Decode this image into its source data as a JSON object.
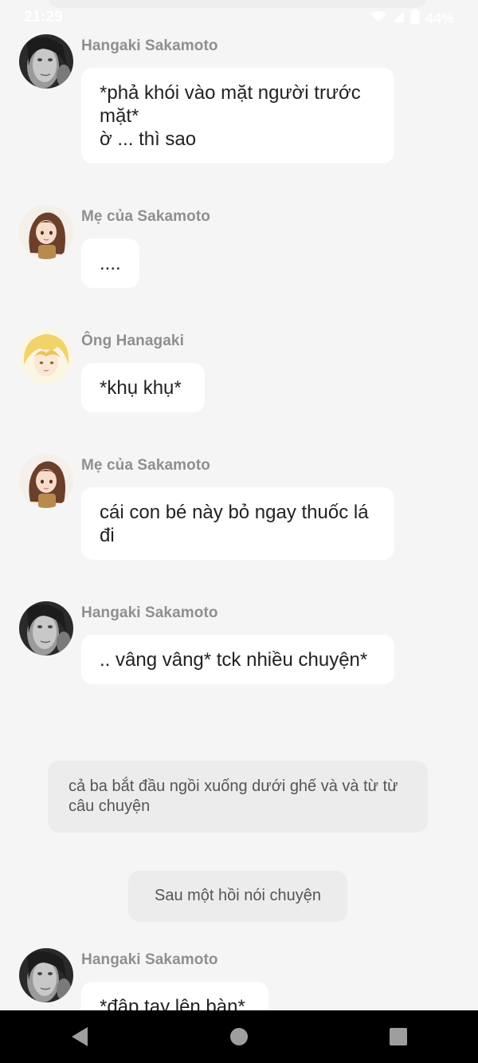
{
  "status_bar": {
    "time": "21:29",
    "battery": "44%"
  },
  "messages": [
    {
      "sender": "Hangaki Sakamoto",
      "avatar": "woman-bw-avatar",
      "text": "*phả khói vào mặt người trước mặt*\nờ ... thì sao"
    },
    {
      "sender": "Mẹ của Sakamoto",
      "avatar": "brown-hair-girl-avatar",
      "text": "...."
    },
    {
      "sender": "Ông Hanagaki",
      "avatar": "blonde-anime-boy-avatar",
      "text": "*khụ khụ*"
    },
    {
      "sender": "Mẹ của Sakamoto",
      "avatar": "brown-hair-girl-avatar",
      "text": "cái con bé này bỏ ngay thuốc lá đi"
    },
    {
      "sender": "Hangaki Sakamoto",
      "avatar": "woman-bw-avatar",
      "text": ".. vâng vâng*  tck nhiều chuyện*"
    },
    {
      "sender": "Hangaki Sakamoto",
      "avatar": "woman-bw-avatar",
      "text": "*đập tay lên bàn*"
    }
  ],
  "narrations": [
    "cả ba bắt đầu ngồi xuống dưới ghế và và từ từ câu chuyện",
    "Sau một hồi nói chuyện"
  ],
  "nav_bar": {
    "back": "back-icon",
    "home": "home-icon",
    "recents": "recents-icon"
  }
}
